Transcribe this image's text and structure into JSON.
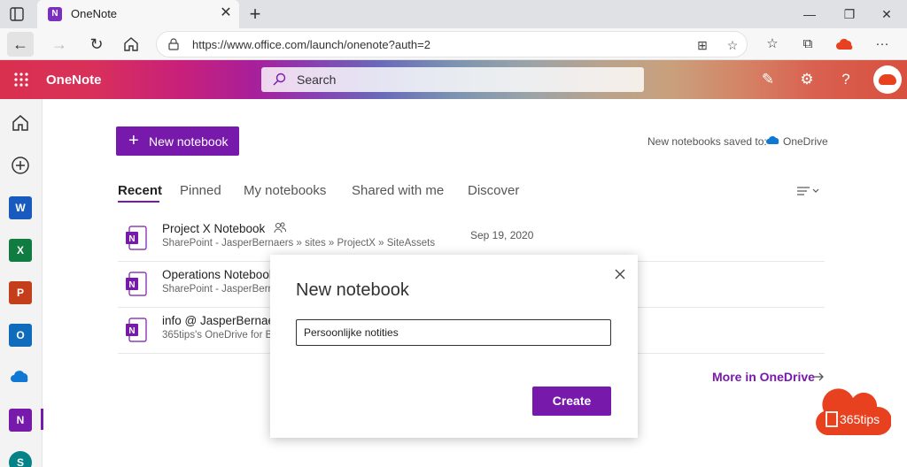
{
  "browser": {
    "tab_title": "OneNote",
    "url": "https://www.office.com/launch/onenote?auth=2",
    "icons": [
      "tab-manager-icon",
      "close-icon",
      "plus-icon",
      "minimize-icon",
      "restore-icon",
      "close-window-icon",
      "back-icon",
      "forward-icon",
      "refresh-icon",
      "home-icon",
      "lock-icon",
      "apps-icon",
      "favorites-add-icon",
      "favorites-icon",
      "collections-icon",
      "office-cloud-icon",
      "more-icon"
    ]
  },
  "header": {
    "app_name": "OneNote",
    "search_placeholder": "Search",
    "gradient_start": "#d9304f",
    "gradient_end": "#d8503f"
  },
  "rail": {
    "items": [
      "home-icon",
      "create-icon",
      "word-icon",
      "excel-icon",
      "powerpoint-icon",
      "outlook-icon",
      "onedrive-icon",
      "onenote-icon",
      "sharepoint-icon"
    ]
  },
  "main": {
    "new_notebook_button": "New notebook",
    "saved_to_label": "New notebooks saved to:",
    "saved_to_location": "OneDrive",
    "tabs": [
      {
        "label": "Recent"
      },
      {
        "label": "Pinned"
      },
      {
        "label": "My notebooks"
      },
      {
        "label": "Shared with me"
      },
      {
        "label": "Discover"
      }
    ],
    "notebooks": [
      {
        "title": "Project X Notebook",
        "path": "SharePoint - JasperBernaers » sites » ProjectX » SiteAssets",
        "date": "Sep 19, 2020"
      },
      {
        "title": "Operations Notebook",
        "path": "SharePoint - JasperBernaers",
        "date": ""
      },
      {
        "title": "info @ JasperBernaers",
        "path": "365tips's OneDrive for Business",
        "date": ""
      }
    ],
    "more_link": "More in OneDrive"
  },
  "modal": {
    "title": "New notebook",
    "input_value": "Persoonlijke notities",
    "create_button": "Create"
  },
  "watermark": {
    "text": "365tips"
  },
  "colors": {
    "accent": "#7719aa"
  }
}
